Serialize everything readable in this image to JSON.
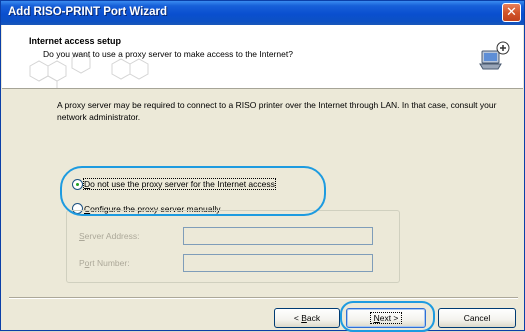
{
  "window": {
    "title": "Add RISO-PRINT Port Wizard",
    "close_glyph": "✕"
  },
  "header": {
    "title": "Internet access setup",
    "subtitle": "Do you want to use a proxy server to make access to the Internet?",
    "icon": "network-computer-plus-icon"
  },
  "description": "A proxy server may be required to connect to a RISO printer over the Internet through LAN. In that case, consult your network administrator.",
  "options": [
    {
      "mnemonic": "D",
      "rest": "o not use the proxy server for the Internet access",
      "selected": true
    },
    {
      "mnemonic": "C",
      "rest": "onfigure the proxy server manually",
      "selected": false
    }
  ],
  "proxy_fields": {
    "server_address": {
      "before": "",
      "mnemonic": "S",
      "after": "erver Address:",
      "value": ""
    },
    "port_number": {
      "before": "P",
      "mnemonic": "o",
      "after": "rt Number:",
      "value": ""
    }
  },
  "buttons": {
    "back": {
      "before": "< ",
      "mnemonic": "B",
      "after": "ack"
    },
    "next": {
      "mnemonic": "N",
      "after": "ext >"
    },
    "cancel": {
      "label": "Cancel"
    }
  },
  "colors": {
    "title_bar": "#0a4fcf",
    "radio_selected": "#21a121",
    "highlight": "#1d9be0"
  }
}
